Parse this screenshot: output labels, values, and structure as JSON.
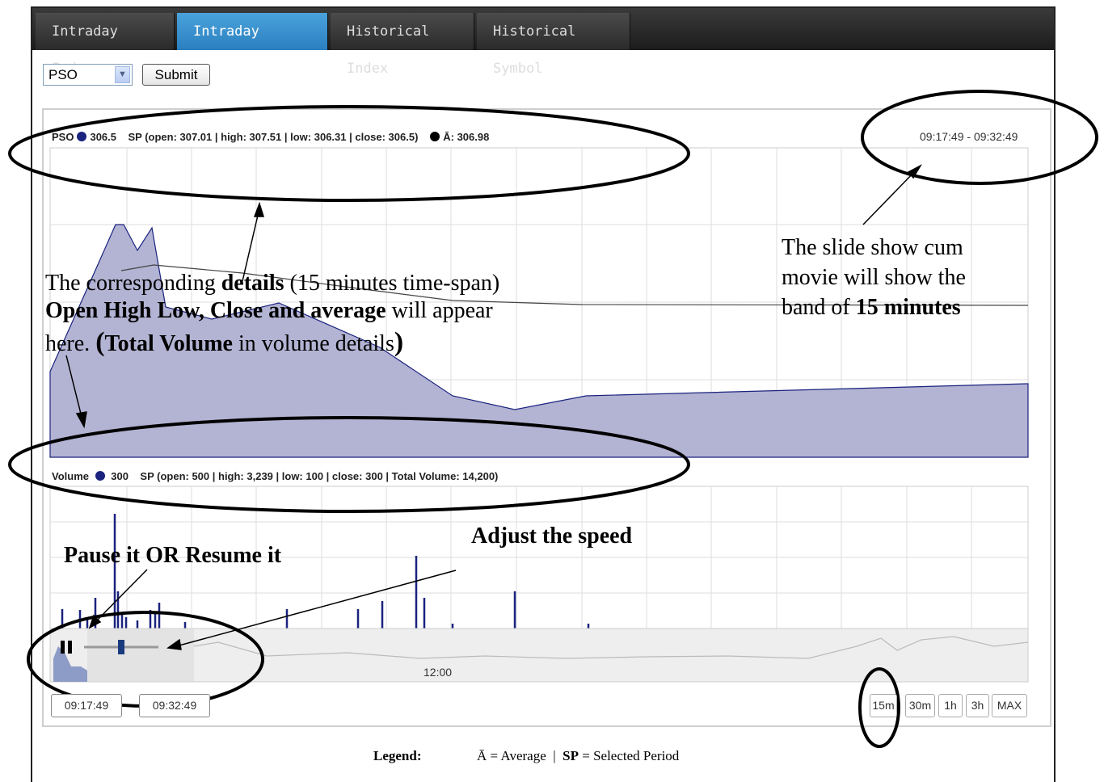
{
  "tabs": [
    {
      "label": "Intraday Index",
      "active": false
    },
    {
      "label": "Intraday Symbol",
      "active": true
    },
    {
      "label": "Historical Index",
      "active": false
    },
    {
      "label": "Historical Symbol",
      "active": false
    }
  ],
  "symbol_select": {
    "value": "PSO"
  },
  "submit_label": "Submit",
  "price_header": {
    "symbol": "PSO",
    "price": "306.5",
    "sp_text": "SP (open: 307.01 | high: 307.51 | low: 306.31 | close: 306.5)",
    "avg_text": "Ā: 306.98"
  },
  "time_range": "09:17:49 - 09:32:49",
  "volume_header": {
    "label": "Volume",
    "value": "300",
    "sp_text": "SP (open: 500 | high: 3,239 | low: 100 | close: 300 | Total Volume: 14,200)"
  },
  "navigator": {
    "axis_label": "12:00"
  },
  "date_from": "09:17:49",
  "date_to": "09:32:49",
  "range_buttons": [
    "15m",
    "30m",
    "1h",
    "3h",
    "MAX"
  ],
  "legend": {
    "title": "Legend:",
    "avg": "Ā = Average",
    "sep": "|",
    "sp_abbr": "SP",
    "sp_def": "=  Selected Period"
  },
  "annotations": {
    "details_1a": "The corresponding ",
    "details_1b": "details",
    "details_1c": " (15 minutes time-span)",
    "details_2a": "Open High Low, Close and average",
    "details_2b": " will appear",
    "details_3a": "here. ",
    "details_3b": "(",
    "details_3c": "Total Volume",
    "details_3d": " in volume details",
    "details_3e": ")",
    "slide_1": "The slide show cum",
    "slide_2": "movie will show the",
    "slide_3a": "band of ",
    "slide_3b": "15 minutes",
    "speed": "Adjust the speed",
    "pause": "Pause it OR Resume it"
  },
  "colors": {
    "tab_active": "#2b7fbf",
    "series_fill": "#b3b3d3",
    "series_line": "#1a237e",
    "volume_bar": "#1a237e"
  },
  "chart_data": {
    "type": "area",
    "price_series": {
      "name": "PSO",
      "note_ranges": "intraday price band"
    },
    "volume_series": {
      "name": "Volume"
    }
  }
}
